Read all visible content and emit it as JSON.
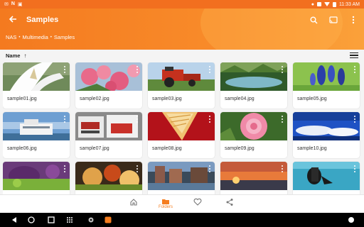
{
  "status_bar": {
    "left_icons": [
      "mail-icon",
      "app-icon",
      "nas-icon"
    ],
    "time": "11:33 AM",
    "right_icons": [
      "notification-icon",
      "cast-icon",
      "wifi-icon",
      "battery-icon"
    ]
  },
  "app_bar": {
    "title": "Samples",
    "actions": [
      "search-icon",
      "cast-icon",
      "more-vert-icon"
    ],
    "breadcrumb": [
      "NAS",
      "Multimedia",
      "Samples"
    ]
  },
  "sort_bar": {
    "sort_label": "Name",
    "sort_direction": "ascending",
    "view_toggle": "list-view-icon"
  },
  "files": [
    {
      "name": "sample01.jpg"
    },
    {
      "name": "sample02.jpg"
    },
    {
      "name": "sample03.jpg"
    },
    {
      "name": "sample04.jpg"
    },
    {
      "name": "sample05.jpg"
    },
    {
      "name": "sample06.jpg"
    },
    {
      "name": "sample07.jpg"
    },
    {
      "name": "sample08.jpg"
    },
    {
      "name": "sample09.jpg"
    },
    {
      "name": "sample10.jpg"
    },
    {
      "name": ""
    },
    {
      "name": ""
    },
    {
      "name": ""
    },
    {
      "name": ""
    },
    {
      "name": ""
    }
  ],
  "bottom_nav": {
    "items": [
      {
        "icon": "home-icon",
        "label": ""
      },
      {
        "icon": "folder-icon",
        "label": "Folders",
        "selected": true
      },
      {
        "icon": "heart-icon",
        "label": ""
      },
      {
        "icon": "share-icon",
        "label": ""
      }
    ]
  },
  "colors": {
    "accent": "#f57d1f",
    "app_bar": "#f47a1f"
  }
}
